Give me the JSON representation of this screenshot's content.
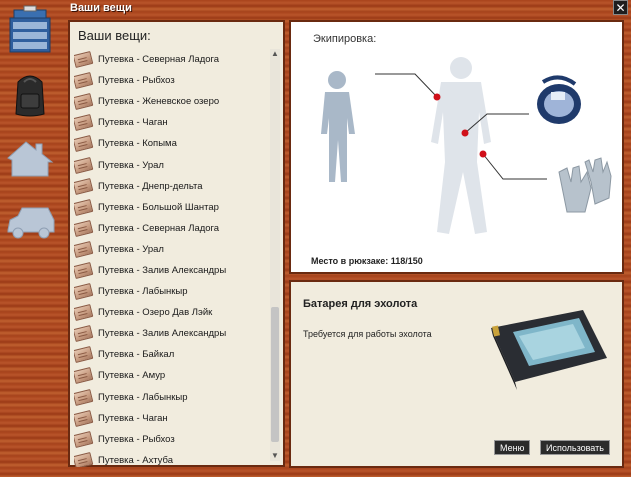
{
  "window": {
    "title": "Ваши вещи",
    "close_symbol": "✕"
  },
  "sidebar": {
    "icons": [
      {
        "name": "tackle-box-icon"
      },
      {
        "name": "backpack-icon"
      },
      {
        "name": "house-icon"
      },
      {
        "name": "car-icon"
      }
    ]
  },
  "items_panel": {
    "title": "Ваши вещи:",
    "items": [
      "Путевка - Северная Ладога",
      "Путевка - Рыбхоз",
      "Путевка - Женевское озеро",
      "Путевка - Чаган",
      "Путевка - Копыма",
      "Путевка - Урал",
      "Путевка - Днепр-дельта",
      "Путевка - Большой Шантар",
      "Путевка - Северная Ладога",
      "Путевка - Урал",
      "Путевка - Залив Александры",
      "Путевка - Лабынкыр",
      "Путевка - Озеро Дав Лэйк",
      "Путевка - Залив Александры",
      "Путевка - Байкал",
      "Путевка - Амур",
      "Путевка - Лабынкыр",
      "Путевка - Чаган",
      "Путевка - Рыбхоз",
      "Путевка - Ахтуба"
    ],
    "scroll_up": "▲",
    "scroll_down": "▼"
  },
  "equipment": {
    "title": "Экипировка:",
    "backpack_text": "Место в рюкзаке: 118/150"
  },
  "detail": {
    "title": "Батарея для эхолота",
    "description": "Требуется для работы эхолота",
    "menu_button": "Меню",
    "use_button": "Использовать"
  }
}
